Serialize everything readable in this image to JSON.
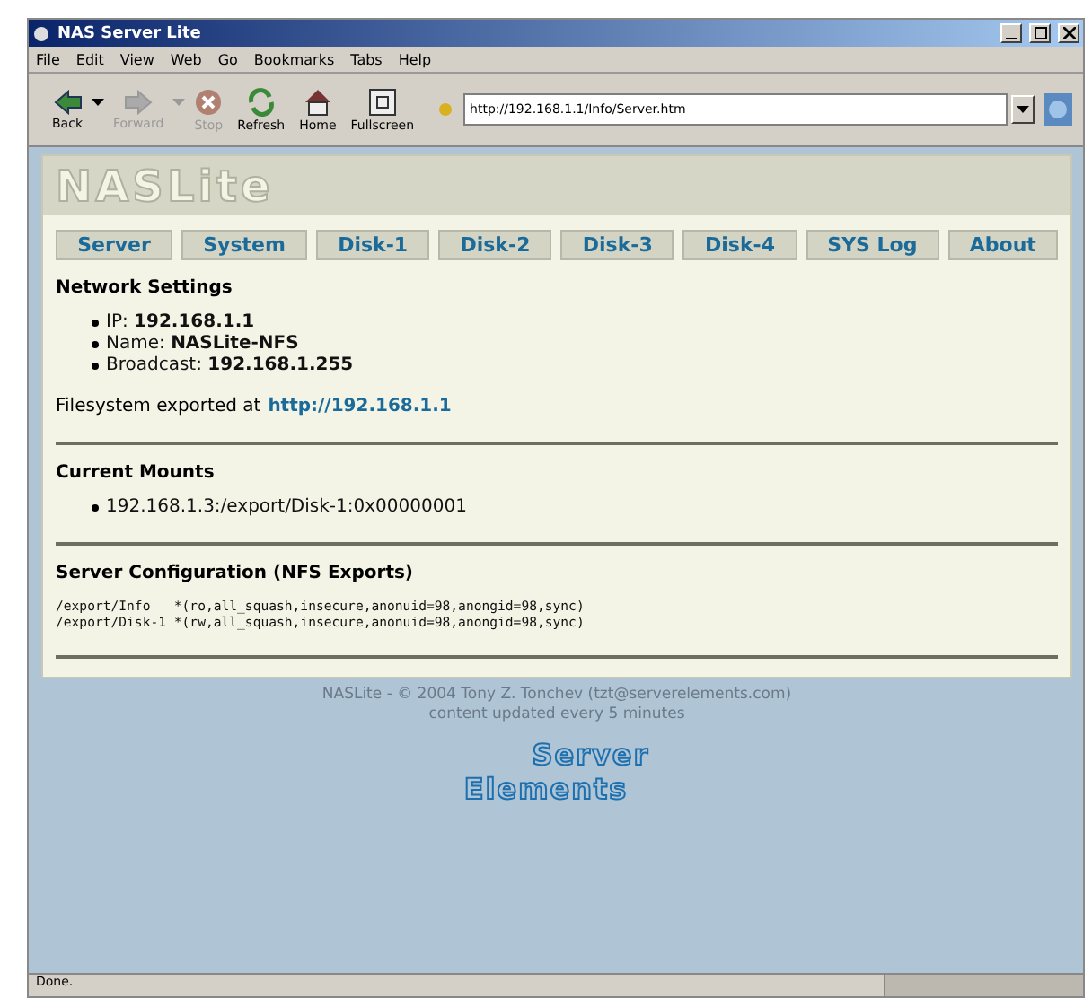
{
  "window": {
    "title": "NAS Server Lite"
  },
  "menu": [
    "File",
    "Edit",
    "View",
    "Web",
    "Go",
    "Bookmarks",
    "Tabs",
    "Help"
  ],
  "toolbar": [
    {
      "kind": "back",
      "label": "Back",
      "disabled": false,
      "dropdown": true
    },
    {
      "kind": "forward",
      "label": "Forward",
      "disabled": true,
      "dropdown": true
    },
    {
      "kind": "stop",
      "label": "Stop",
      "disabled": true,
      "dropdown": false
    },
    {
      "kind": "refresh",
      "label": "Refresh",
      "disabled": false,
      "dropdown": false
    },
    {
      "kind": "home",
      "label": "Home",
      "disabled": false,
      "dropdown": false
    },
    {
      "kind": "fullscreen",
      "label": "Fullscreen",
      "disabled": false,
      "dropdown": false
    }
  ],
  "address": {
    "value": "http://192.168.1.1/Info/Server.htm"
  },
  "page": {
    "logo": "NASLite",
    "nav": [
      "Server",
      "System",
      "Disk-1",
      "Disk-2",
      "Disk-3",
      "Disk-4",
      "SYS Log",
      "About"
    ],
    "network": {
      "heading": "Network Settings",
      "items": [
        "IP: **192.168.1.1**",
        "Name: **NASLite-NFS**",
        "Broadcast: **192.168.1.255**"
      ],
      "export_text": "Filesystem exported at",
      "export_link": "http://192.168.1.1"
    },
    "mounts": {
      "heading": "Current Mounts",
      "items": [
        "192.168.1.3:/export/Disk-1:0x00000001"
      ]
    },
    "config": {
      "heading": "Server Configuration (NFS Exports)",
      "lines": [
        "/export/Info   *(ro,all_squash,insecure,anonuid=98,anongid=98,sync)",
        "/export/Disk-1 *(rw,all_squash,insecure,anonuid=98,anongid=98,sync)"
      ]
    },
    "footer": [
      "NASLite - © 2004 Tony Z. Tonchev (tzt@serverelements.com)",
      "content updated every 5 minutes"
    ],
    "vendor_logo": [
      "Server",
      "Elements"
    ]
  },
  "status_bar": {
    "text": "Done."
  }
}
